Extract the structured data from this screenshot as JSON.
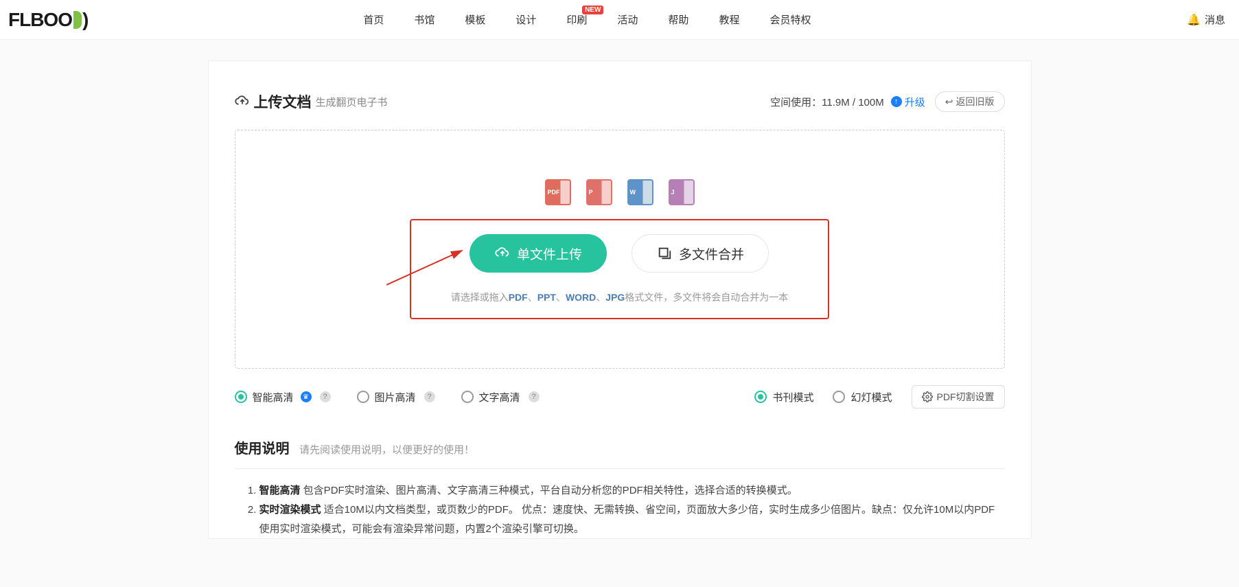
{
  "header": {
    "logo": "FLBOOK",
    "nav": [
      "首页",
      "书馆",
      "模板",
      "设计",
      "印刷",
      "活动",
      "帮助",
      "教程",
      "会员特权"
    ],
    "new_badge": "NEW",
    "message": "消息"
  },
  "title": {
    "main": "上传文档",
    "sub": "生成翻页电子书",
    "space_label": "空间使用：",
    "space_used": "11.9M",
    "space_sep": " / ",
    "space_total": "100M",
    "upgrade": "升级",
    "return_old": "返回旧版"
  },
  "dropzone": {
    "file_types": [
      "PDF",
      "P",
      "W",
      "J"
    ],
    "btn_single": "单文件上传",
    "btn_multi": "多文件合并",
    "hint_prefix": "请选择或拖入",
    "hint_formats": [
      "PDF",
      "PPT",
      "WORD",
      "JPG"
    ],
    "hint_suffix": "格式文件，多文件将会自动合并为一本"
  },
  "quality": {
    "smart": "智能高清",
    "image": "图片高清",
    "text": "文字高清"
  },
  "mode": {
    "book": "书刊模式",
    "slide": "幻灯模式",
    "pdf_cut": "PDF切割设置"
  },
  "instructions": {
    "title": "使用说明",
    "sub": "请先阅读使用说明，以便更好的使用！",
    "items": [
      {
        "b": "智能高清",
        "t": " 包含PDF实时渲染、图片高清、文字高清三种模式，平台自动分析您的PDF相关特性，选择合适的转换模式。"
      },
      {
        "b": "实时渲染模式",
        "t": " 适合10M以内文档类型，或页数少的PDF。 优点：速度快、无需转换、省空间，页面放大多少倍，实时生成多少倍图片。缺点：仅允许10M以内PDF使用实时渲染模式，可能会有渲染异常问题，内置2个渲染引擎可切换。"
      }
    ]
  }
}
